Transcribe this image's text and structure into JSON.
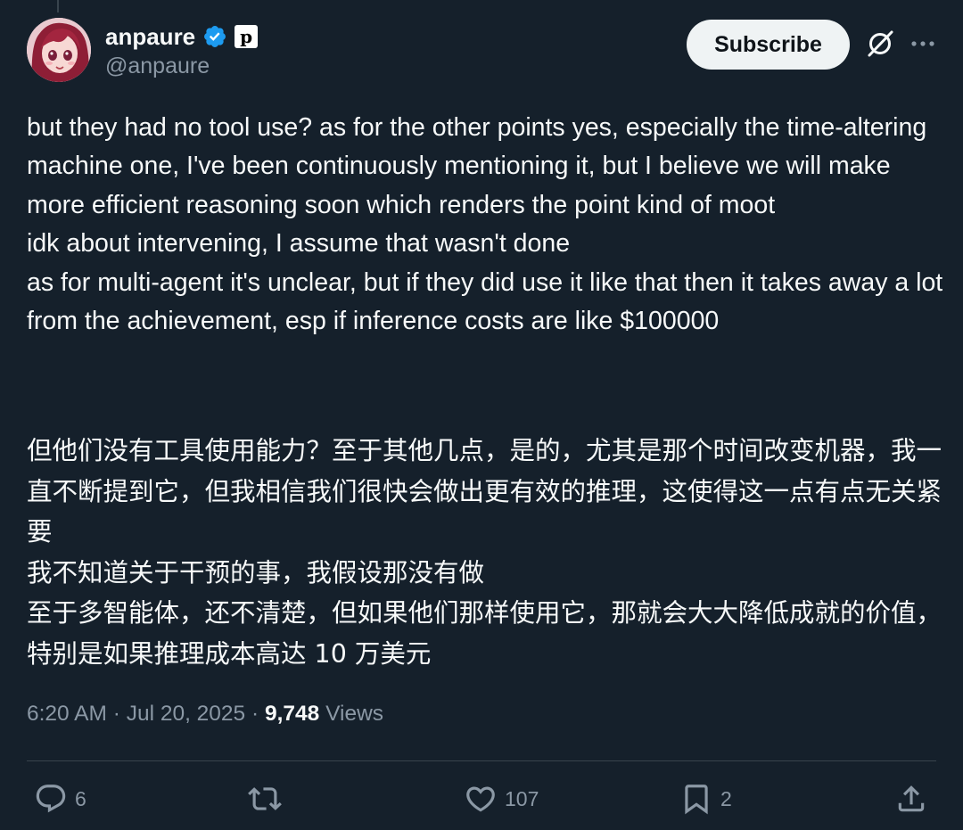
{
  "author": {
    "display_name": "anpaure",
    "handle": "@anpaure",
    "affiliate_badge": "p"
  },
  "actions": {
    "subscribe_label": "Subscribe"
  },
  "tweet": {
    "text": "but they had no tool use? as for the other points yes, especially the time-altering machine one, I've been continuously mentioning it, but I believe we will make more efficient reasoning soon which renders the point kind of moot\nidk about intervening, I assume that wasn't done\nas for multi-agent it's unclear, but if they did use it like that then it takes away a lot from the achievement, esp if inference costs are like $100000",
    "translation": "但他们没有工具使用能力？至于其他几点，是的，尤其是那个时间改变机器，我一直不断提到它，但我相信我们很快会做出更有效的推理，这使得这一点有点无关紧要\n我不知道关于干预的事，我假设那没有做\n至于多智能体，还不清楚，但如果他们那样使用它，那就会大大降低成就的价值，特别是如果推理成本高达 10 万美元",
    "time": "6:20 AM",
    "separator": "·",
    "date": "Jul 20, 2025",
    "views_count": "9,748",
    "views_label": "Views"
  },
  "engagement": {
    "replies": "6",
    "retweets": "",
    "likes": "107",
    "bookmarks": "2"
  },
  "colors": {
    "background": "#15202b",
    "text_primary": "#f7f9f9",
    "text_secondary": "#8b98a5",
    "verified": "#1d9bf0",
    "divider": "#38444d",
    "subscribe_bg": "#eff3f4"
  },
  "icons": {
    "verified": "verified-badge-icon",
    "grok": "grok-icon",
    "more": "more-icon",
    "reply": "reply-icon",
    "retweet": "retweet-icon",
    "like": "heart-icon",
    "bookmark": "bookmark-icon",
    "share": "share-icon"
  }
}
